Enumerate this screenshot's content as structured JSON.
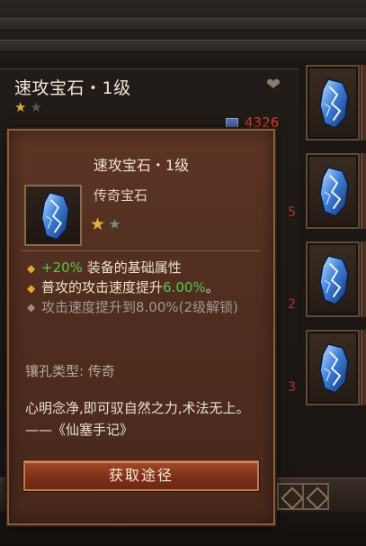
{
  "background_item": {
    "title": "速攻宝石・1级",
    "stars_filled": 1,
    "stars_total": 2,
    "heart_icon": "heart-icon",
    "power_value": "4326",
    "side_fragments": [
      "5",
      "2",
      "3"
    ]
  },
  "tooltip": {
    "title": "速攻宝石・1级",
    "rarity": "传奇宝石",
    "stars_filled": 1,
    "stars_total": 2,
    "affixes": [
      {
        "prefix": "+20%",
        "text": " 装备的基础属性",
        "active": true
      },
      {
        "text": "普攻的攻击速度提升",
        "highlight": "6.00%",
        "suffix": "。",
        "active": true
      },
      {
        "text": "攻击速度提升到8.00%(2级解锁)",
        "active": false
      }
    ],
    "socket_label": "镶孔类型:",
    "socket_value": "传奇",
    "flavor": "心明念净,即可驭自然之力,术法无上。——《仙塞手记》",
    "button_label": "获取途径"
  },
  "inventory": {
    "slot_count": 4,
    "item_icon": "blue-gem-icon"
  },
  "colors": {
    "tooltip_bg": "#5c3524",
    "highlight_green": "#59c64c",
    "diamond_gold": "#e2a52e",
    "star_gold": "#e0b040",
    "power_red": "#d23c2c"
  }
}
